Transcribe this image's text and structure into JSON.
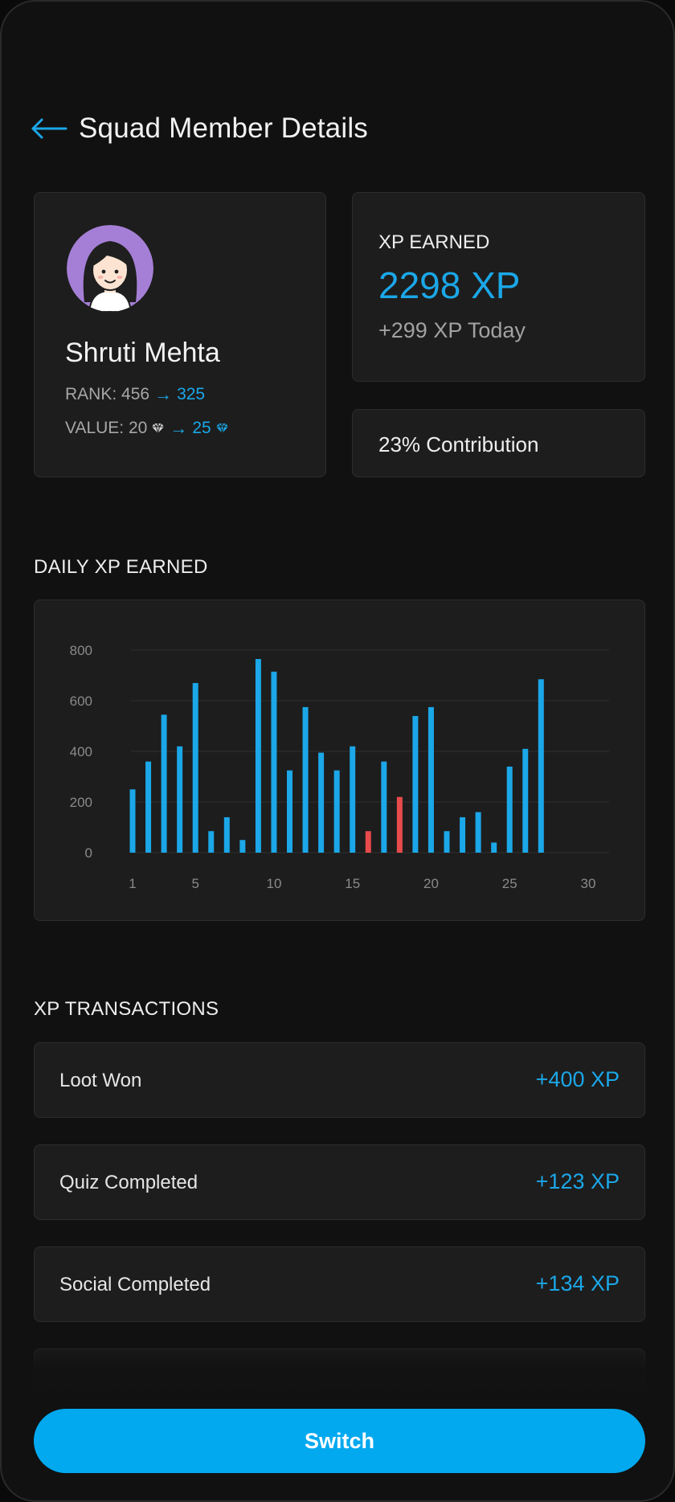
{
  "header": {
    "title": "Squad Member Details",
    "back_icon": "arrow-left-icon",
    "accent_color": "#1ba7e8"
  },
  "profile": {
    "name": "Shruti Mehta",
    "avatar_icon": "avatar-girl-icon",
    "rank_label": "RANK: 456",
    "rank_new": "325",
    "value_label": "VALUE: 20",
    "value_new": "25",
    "arrow": "→",
    "gem_icon": "diamond-icon"
  },
  "xp": {
    "label": "XP EARNED",
    "value": "2298 XP",
    "today": "+299 XP Today"
  },
  "contribution": {
    "text": "23% Contribution"
  },
  "daily_section_title": "DAILY XP EARNED",
  "chart_data": {
    "type": "bar",
    "title": "",
    "xlabel": "",
    "ylabel": "",
    "x": [
      1,
      2,
      3,
      4,
      5,
      6,
      7,
      8,
      9,
      10,
      11,
      12,
      13,
      14,
      15,
      16,
      17,
      18,
      19,
      20,
      21,
      22,
      23,
      24,
      25,
      26,
      27
    ],
    "values": [
      250,
      360,
      545,
      420,
      670,
      85,
      140,
      50,
      765,
      715,
      325,
      575,
      395,
      325,
      420,
      85,
      360,
      220,
      540,
      575,
      85,
      140,
      160,
      40,
      340,
      410,
      685
    ],
    "highlighted_x": [
      16,
      18
    ],
    "bar_color": "#1ba7e8",
    "highlight_color": "#e84b4b",
    "ylim": [
      0,
      800
    ],
    "xlim": [
      1,
      30
    ],
    "y_ticks": [
      0,
      200,
      400,
      600,
      800
    ],
    "x_ticks": [
      1,
      5,
      10,
      15,
      20,
      25,
      30
    ],
    "grid": true
  },
  "transactions_section_title": "XP TRANSACTIONS",
  "transactions": [
    {
      "label": "Loot Won",
      "amount": "+400 XP"
    },
    {
      "label": "Quiz Completed",
      "amount": "+123 XP"
    },
    {
      "label": "Social Completed",
      "amount": "+134 XP"
    }
  ],
  "switch_button": {
    "label": "Switch",
    "color": "#03a9ef"
  }
}
